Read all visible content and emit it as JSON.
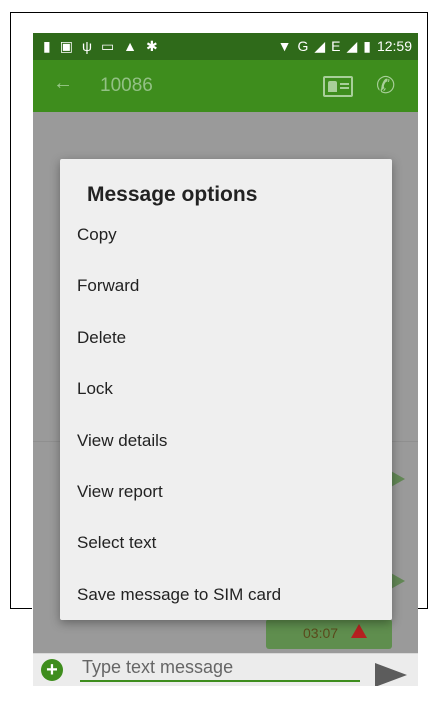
{
  "status_bar": {
    "left_icons": [
      "notification-icon",
      "image-icon",
      "usb-icon",
      "battery-saver-icon",
      "warning-icon",
      "android-debug-icon"
    ],
    "network_label": "G",
    "network_label_2": "E",
    "time": "12:59"
  },
  "app_bar": {
    "contact_number": "10086"
  },
  "dialog": {
    "title": "Message options",
    "items": [
      {
        "label": "Copy"
      },
      {
        "label": "Forward"
      },
      {
        "label": "Delete"
      },
      {
        "label": "Lock"
      },
      {
        "label": "View details"
      },
      {
        "label": "View report"
      },
      {
        "label": "Select text"
      },
      {
        "label": "Save message to SIM card"
      }
    ]
  },
  "conversation": {
    "message_time": "03:07"
  },
  "composer": {
    "placeholder": "Type text message"
  },
  "colors": {
    "status_bar": "#2f6a1a",
    "app_bar": "#3e8d1d",
    "dialog_background": "#efefef",
    "error_red": "#b52020"
  }
}
